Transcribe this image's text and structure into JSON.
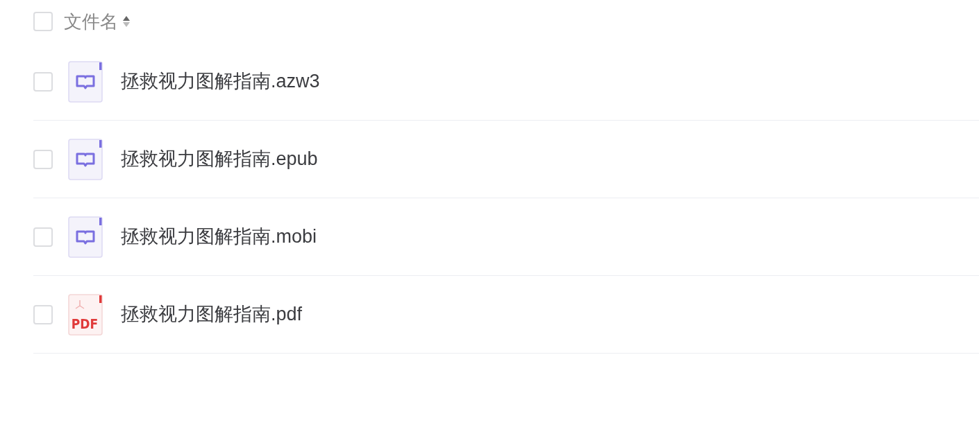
{
  "header": {
    "label": "文件名",
    "checked": false
  },
  "files": [
    {
      "name": "拯救视力图解指南.azw3",
      "kind": "ebook",
      "checked": false
    },
    {
      "name": "拯救视力图解指南.epub",
      "kind": "ebook",
      "checked": false
    },
    {
      "name": "拯救视力图解指南.mobi",
      "kind": "ebook",
      "checked": false
    },
    {
      "name": "拯救视力图解指南.pdf",
      "kind": "pdf",
      "icon_label": "PDF",
      "checked": false
    }
  ]
}
